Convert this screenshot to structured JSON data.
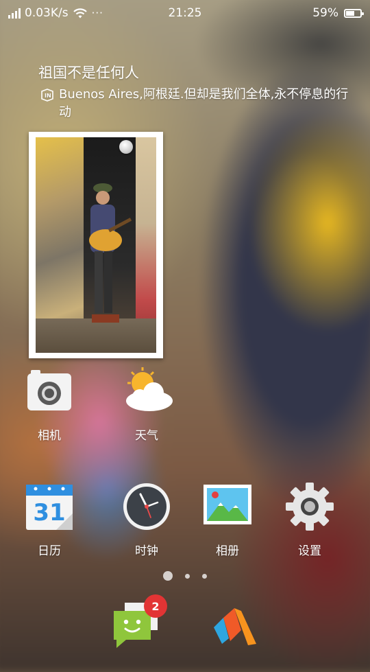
{
  "status_bar": {
    "speed": "0.03K/s",
    "overflow": "···",
    "time": "21:25",
    "battery_percent": "59%",
    "battery_level": 0.59,
    "icons": [
      "signal-icon",
      "wifi-icon",
      "more-icon",
      "battery-icon"
    ]
  },
  "wallpaper_info": {
    "headline": "祖国不是任何人",
    "caption": "Buenos Aires,阿根廷.但却是我们全体,永不停息的行动"
  },
  "apps": {
    "row1": [
      {
        "label": "相机",
        "icon": "camera-icon"
      },
      {
        "label": "天气",
        "icon": "weather-icon"
      }
    ],
    "row2": [
      {
        "label": "日历",
        "icon": "calendar-icon",
        "calendar_day": "31"
      },
      {
        "label": "时钟",
        "icon": "clock-icon"
      },
      {
        "label": "相册",
        "icon": "gallery-icon"
      },
      {
        "label": "设置",
        "icon": "settings-gear-icon"
      }
    ]
  },
  "page_indicator": {
    "pages": 3,
    "current": 1
  },
  "dock": {
    "messages_badge": "2",
    "apps": [
      {
        "icon": "messages-icon"
      },
      {
        "icon": "browser-icon"
      }
    ]
  },
  "colors": {
    "badge": "#e23434",
    "messages_green": "#8fc63c",
    "settings_gray": "#e6e6e6"
  }
}
